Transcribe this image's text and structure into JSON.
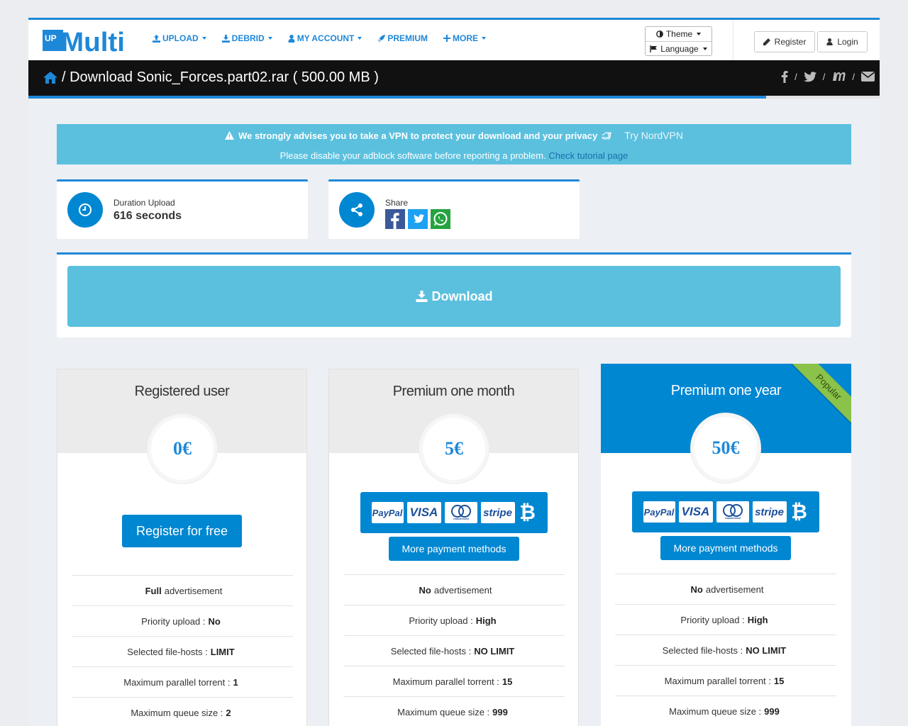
{
  "brand": {
    "logo_up": "UP",
    "logo_text": "Multi"
  },
  "nav": {
    "items": [
      {
        "label": "UPLOAD",
        "icon": "upload-icon"
      },
      {
        "label": "DEBRID",
        "icon": "download-icon"
      },
      {
        "label": "MY ACCOUNT",
        "icon": "user-icon"
      },
      {
        "label": "PREMIUM",
        "icon": "rocket-icon"
      },
      {
        "label": "MORE",
        "icon": "plus-icon"
      }
    ],
    "theme_label": "Theme",
    "language_label": "Language",
    "register_label": "Register",
    "login_label": "Login"
  },
  "page": {
    "title": "/ Download Sonic_Forces.part02.rar ( 500.00 MB )",
    "progress_percent": 86.7
  },
  "alert": {
    "line1": "We strongly advises you to take a VPN to protect your download and your privacy",
    "vpn_link": "Try NordVPN",
    "line2": "Please disable your adblock software before reporting a problem.",
    "tutorial_link": "Check tutorial page"
  },
  "info": {
    "duration_label": "Duration Upload",
    "duration_value": "616 seconds",
    "share_label": "Share"
  },
  "download": {
    "label": "Download"
  },
  "plans": [
    {
      "title": "Registered user",
      "price": "0€",
      "cta": "Register for free",
      "features": [
        {
          "pre": "",
          "bold": "Full",
          "post": " advertisement"
        },
        {
          "pre": "Priority upload : ",
          "bold": "No",
          "post": ""
        },
        {
          "pre": "Selected file-hosts : ",
          "bold": "LIMIT",
          "post": ""
        },
        {
          "pre": "Maximum parallel torrent : ",
          "bold": "1",
          "post": ""
        },
        {
          "pre": "Maximum queue size : ",
          "bold": "2",
          "post": ""
        }
      ]
    },
    {
      "title": "Premium one month",
      "price": "5€",
      "more": "More payment methods",
      "features": [
        {
          "pre": "",
          "bold": "No",
          "post": " advertisement"
        },
        {
          "pre": "Priority upload : ",
          "bold": "High",
          "post": ""
        },
        {
          "pre": "Selected file-hosts : ",
          "bold": "NO LIMIT",
          "post": ""
        },
        {
          "pre": "Maximum parallel torrent : ",
          "bold": "15",
          "post": ""
        },
        {
          "pre": "Maximum queue size : ",
          "bold": "999",
          "post": ""
        }
      ]
    },
    {
      "title": "Premium one year",
      "price": "50€",
      "ribbon": "Popular",
      "more": "More payment methods",
      "features": [
        {
          "pre": "",
          "bold": "No",
          "post": " advertisement"
        },
        {
          "pre": "Priority upload : ",
          "bold": "High",
          "post": ""
        },
        {
          "pre": "Selected file-hosts : ",
          "bold": "NO LIMIT",
          "post": ""
        },
        {
          "pre": "Maximum parallel torrent : ",
          "bold": "15",
          "post": ""
        },
        {
          "pre": "Maximum queue size : ",
          "bold": "999",
          "post": ""
        }
      ]
    }
  ],
  "payment_methods": [
    "PayPal",
    "VISA",
    "mastercard",
    "stripe",
    "₿"
  ],
  "colors": {
    "primary": "#0087d2",
    "accent": "#1e88d8",
    "info": "#5bc0de",
    "dark": "#111111"
  }
}
